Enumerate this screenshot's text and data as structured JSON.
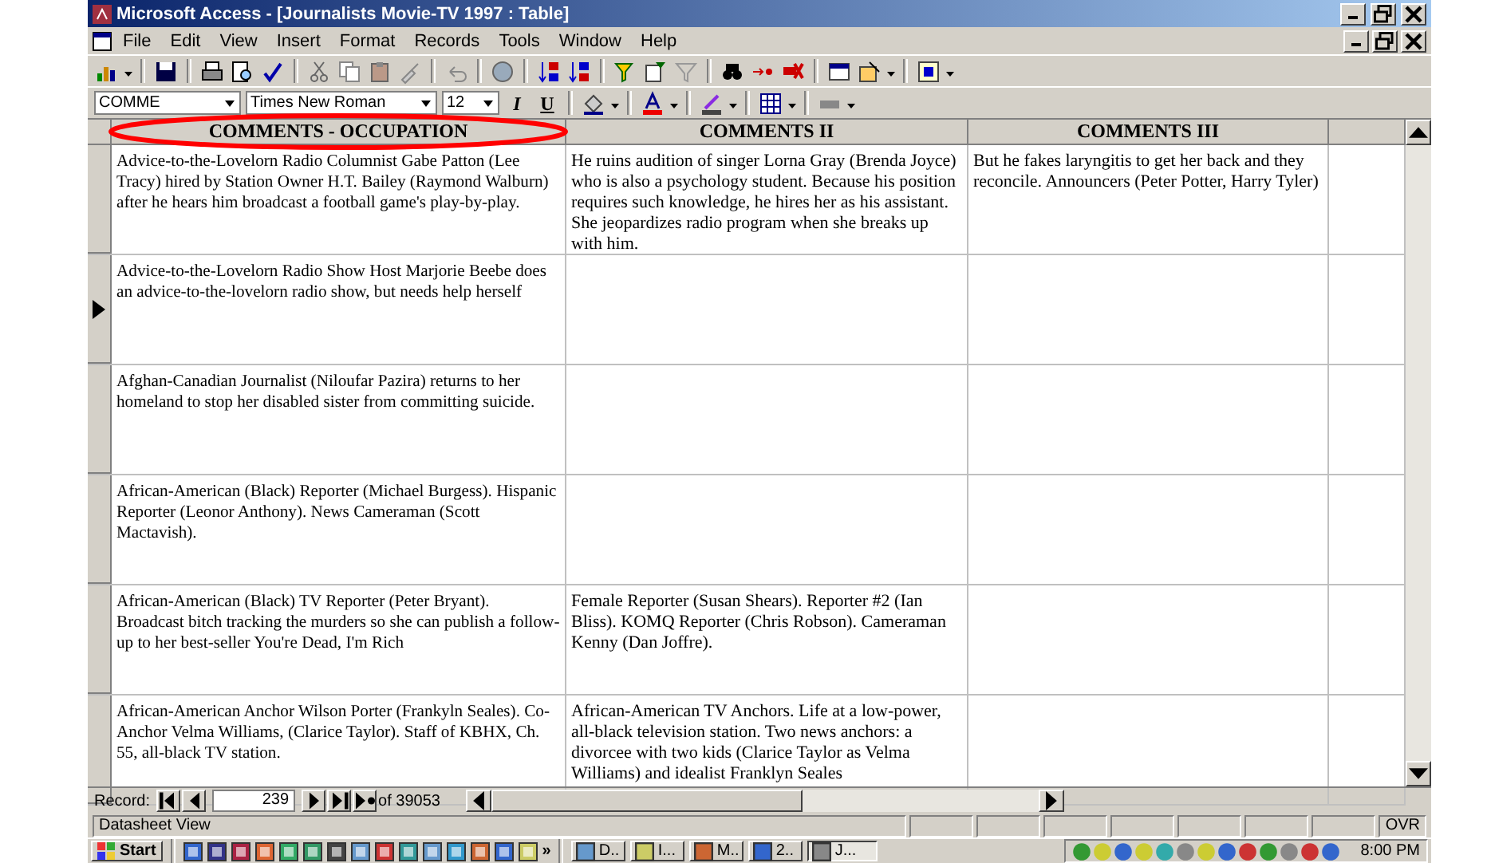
{
  "window": {
    "title": "Microsoft Access - [Journalists Movie-TV 1997 : Table]"
  },
  "menu": [
    "File",
    "Edit",
    "View",
    "Insert",
    "Format",
    "Records",
    "Tools",
    "Window",
    "Help"
  ],
  "format_toolbar": {
    "field": "COMME",
    "font": "Times New Roman",
    "size": "12",
    "style_buttons": [
      "I",
      "U"
    ]
  },
  "annotation": {
    "kind": "ellipse"
  },
  "table": {
    "columns": [
      "COMMENTS - OCCUPATION",
      "COMMENTS II",
      "COMMENTS III"
    ],
    "rows": [
      {
        "current": false,
        "cells": [
          "Advice-to-the-Lovelorn Radio Columnist Gabe Patton (Lee Tracy) hired by Station Owner H.T. Bailey (Raymond Walburn) after he hears him broadcast a football game's play-by-play.",
          "He ruins audition of singer Lorna Gray (Brenda Joyce) who is also a psychology student. Because his position requires such knowledge, he hires her as his assistant. She jeopardizes radio program when she breaks up with him.",
          "But he fakes laryngitis to get her back and they reconcile. Announcers (Peter Potter, Harry Tyler)"
        ]
      },
      {
        "current": true,
        "cells": [
          "Advice-to-the-Lovelorn Radio Show Host Marjorie Beebe does an advice-to-the-lovelorn radio show, but needs help herself",
          "",
          ""
        ]
      },
      {
        "current": false,
        "cells": [
          "Afghan-Canadian Journalist (Niloufar Pazira) returns to her homeland to stop her disabled sister from committing suicide.",
          "",
          ""
        ]
      },
      {
        "current": false,
        "cells": [
          "African-American (Black) Reporter (Michael Burgess). Hispanic Reporter (Leonor Anthony). News Cameraman (Scott Mactavish).",
          "",
          ""
        ]
      },
      {
        "current": false,
        "cells": [
          "African-American (Black) TV Reporter (Peter Bryant). Broadcast bitch tracking the murders so she can publish a follow-up to her best-seller You're Dead, I'm Rich",
          "Female Reporter (Susan Shears). Reporter #2 (Ian Bliss). KOMQ Reporter (Chris Robson). Cameraman Kenny (Dan Joffre).",
          ""
        ]
      },
      {
        "current": false,
        "cells": [
          "African-American Anchor Wilson Porter (Frankyln Seales). Co-Anchor Velma Williams, (Clarice Taylor). Staff of KBHX, Ch. 55, all-black TV station.",
          "African-American TV Anchors. Life at a low-power, all-black television station. Two news anchors: a divorcee with two kids (Clarice Taylor as Velma Williams) and idealist Franklyn Seales",
          ""
        ]
      }
    ]
  },
  "navigation": {
    "label": "Record:",
    "current": "239",
    "total": "of 39053"
  },
  "status_bar": {
    "text": "Datasheet View",
    "indicator": "OVR"
  },
  "taskbar": {
    "start": "Start",
    "overflow": "»",
    "tasks": [
      {
        "label": "D..",
        "selected": false
      },
      {
        "label": "I...",
        "selected": false
      },
      {
        "label": "M..",
        "selected": false
      },
      {
        "label": "2..",
        "selected": false
      },
      {
        "label": "J...",
        "selected": true
      }
    ],
    "clock": "8:00 PM"
  }
}
